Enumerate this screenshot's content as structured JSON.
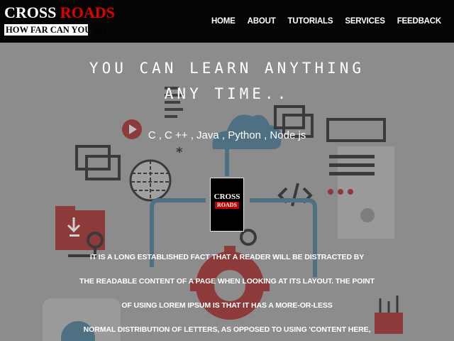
{
  "brand": {
    "word1": "CROSS",
    "word2": "ROADS",
    "tagline": "HOW FAR CAN YOU GO"
  },
  "nav": {
    "items": [
      "HOME",
      "ABOUT",
      "TUTORIALS",
      "SERVICES",
      "FEEDBACK"
    ]
  },
  "hero": {
    "headline_line1": "YOU CAN LEARN ANYTHING",
    "headline_line2": "ANY TIME..",
    "languages": "C , C ++ , Java , Python , Node js",
    "logo_word1": "CROSS",
    "logo_word2": "ROADS",
    "paragraph_lines": [
      "IT IS A LONG ESTABLISHED FACT THAT A READER WILL BE DISTRACTED BY",
      "THE READABLE CONTENT OF A PAGE WHEN LOOKING AT ITS LAYOUT. THE POINT",
      "OF USING LOREM IPSUM IS THAT IT HAS A MORE-OR-LESS",
      "NORMAL DISTRIBUTION OF LETTERS, AS OPPOSED TO USING 'CONTENT HERE,"
    ]
  },
  "colors": {
    "nav_bg": "#050505",
    "accent_red": "#e00000",
    "overlay": "#8c8c8c"
  }
}
